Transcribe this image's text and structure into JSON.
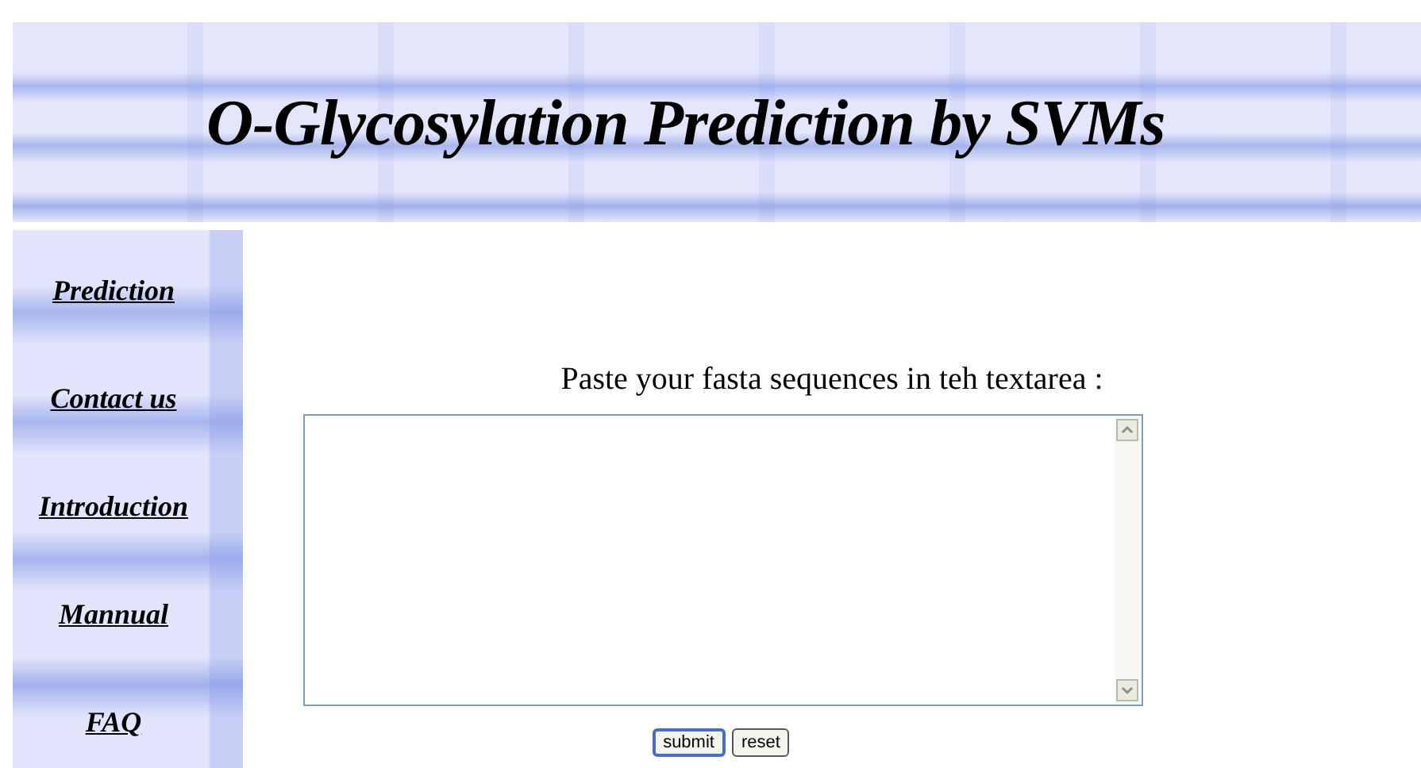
{
  "banner": {
    "title": "O-Glycosylation Prediction by SVMs"
  },
  "sidebar": {
    "items": [
      {
        "label": "Prediction"
      },
      {
        "label": "Contact us"
      },
      {
        "label": "Introduction"
      },
      {
        "label": "Mannual"
      },
      {
        "label": "FAQ"
      }
    ]
  },
  "form": {
    "prompt": "Paste your fasta sequences in teh textarea :",
    "buttons": [
      {
        "label": "submit"
      },
      {
        "label": "reset"
      }
    ]
  }
}
